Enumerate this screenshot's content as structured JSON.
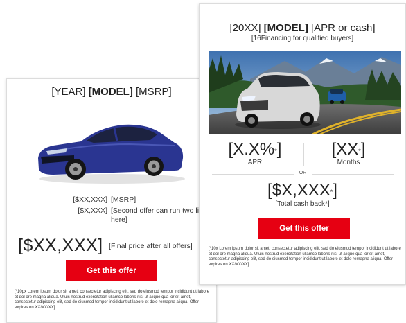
{
  "card1": {
    "title_pre": "[YEAR] ",
    "title_bold": "[MODEL]",
    "title_post": " [MSRP]",
    "rows": [
      {
        "amount": "[$XX,XXX]",
        "label": "[MSRP]"
      },
      {
        "amount": "[$X,XXX]",
        "label": "[Second offer can run two lines here]"
      }
    ],
    "final_amount": "[$XX,XXX]",
    "final_label": "[Final price after all offers]",
    "cta": "Get this offer",
    "fine_print": "[*10px Lorem ipsum dolor sit amet, consectetur adipiscing elit, sed do eiusmod tempor incididunt ut labore et dol ore magna aliqua. Utuis nostrud exercitation ullamco laboris nisi ut alique qua lor sit amet, consectetur adipiscing elit, sed do eiusmod tempor incididunt ut labore et dolo remagna aliqua. Offer expires on XX/XX/XX]."
  },
  "card2": {
    "title_pre": "[20XX] ",
    "title_bold": "[MODEL]",
    "title_post": " [APR or cash]",
    "subtitle": "[16Financing for qualified buyers]",
    "apr_value": "[X.X%",
    "apr_suffix": "]",
    "apr_caption": "APR",
    "months_value": "[XX",
    "months_suffix": "]",
    "months_caption": "Months",
    "or_label": "OR",
    "cash_value": "[$X,XXX",
    "cash_suffix": "]",
    "cash_caption": "[Total cash back*]",
    "cta": "Get this offer",
    "fine_print": "[*10x Lorem ipsum dolor sit amet, consectetur adipiscing elit, sed do eiusmod tempor incididunt ut labore et dol ore magna aliqua. Utuis nostrud exercitation ullamco laboris nisi ut alique qua lor sit amet, consectetur adipiscing elit, sed do eiusmod tempor incididunt ut labore et dolo remagna aliqua. Offer expires on XX/XX/XX]."
  },
  "colors": {
    "cta": "#e60012",
    "car_sedan": "#2a3591",
    "suv": "#d8d8d8"
  },
  "icons": {
    "car1": "sedan-photo",
    "car2": "suv-road-photo"
  }
}
